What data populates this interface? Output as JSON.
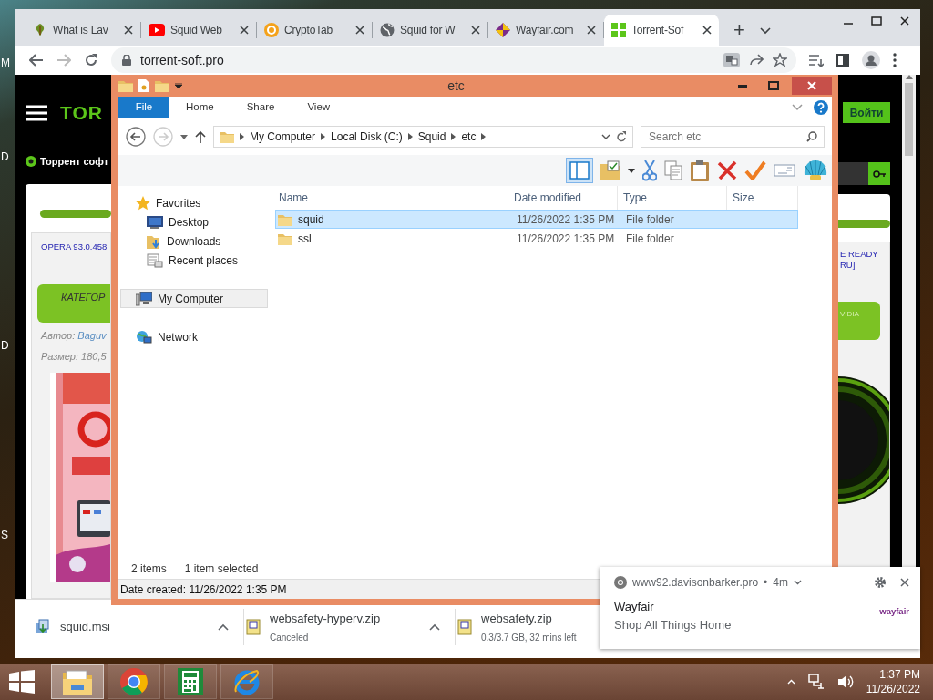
{
  "desktop": {
    "edge_labels": [
      "M",
      "D",
      "D",
      "S"
    ]
  },
  "browser": {
    "tabs": [
      {
        "title": "What is Lav",
        "selected": false
      },
      {
        "title": "Squid Web",
        "selected": false
      },
      {
        "title": "CryptoTab",
        "selected": false
      },
      {
        "title": "Squid for W",
        "selected": false
      },
      {
        "title": "Wayfair.com",
        "selected": false
      },
      {
        "title": "Torrent-Sof",
        "selected": true
      }
    ],
    "new_tab": "+",
    "url": "torrent-soft.pro",
    "page": {
      "logo": "TOR",
      "site_link": "Торрент софт",
      "login_button": "Войти",
      "post_title_left": "OPERA 93.0.458",
      "post_title_right": [
        "E READY",
        "RU]"
      ],
      "category_left": "КАТЕГОР",
      "category_right": "VIDIA",
      "author_label": "Автор:",
      "author": "Baguv",
      "size": "Размер: 180,5"
    },
    "downloads": [
      {
        "name": "squid.msi"
      },
      {
        "name": "websafety-hyperv.zip",
        "status": "Canceled"
      },
      {
        "name": "websafety.zip",
        "status": "0.3/3.7 GB, 32 mins left"
      }
    ]
  },
  "explorer": {
    "title": "etc",
    "ribbon_tabs": [
      {
        "label": "File",
        "kind": "menu",
        "selected": false
      },
      {
        "label": "Home",
        "kind": "tab",
        "selected": false
      },
      {
        "label": "Share",
        "kind": "tab",
        "selected": false
      },
      {
        "label": "View",
        "kind": "tab",
        "selected": false
      }
    ],
    "breadcrumb": [
      "My Computer",
      "Local Disk (C:)",
      "Squid",
      "etc"
    ],
    "search": {
      "placeholder": "Search etc"
    },
    "nav": [
      {
        "label": "Favorites",
        "selected": false,
        "children": [
          {
            "label": "Desktop",
            "selected": false
          },
          {
            "label": "Downloads",
            "selected": false
          },
          {
            "label": "Recent places",
            "selected": false
          }
        ]
      },
      {
        "label": "My Computer",
        "selected": true
      },
      {
        "label": "Network",
        "selected": false
      }
    ],
    "columns": [
      "Name",
      "Date modified",
      "Type",
      "Size"
    ],
    "files": [
      {
        "name": "squid",
        "date": "11/26/2022 1:35 PM",
        "type": "File folder",
        "selected": true
      },
      {
        "name": "ssl",
        "date": "11/26/2022 1:35 PM",
        "type": "File folder",
        "selected": false
      }
    ],
    "status": {
      "count": "2 items",
      "selection": "1 item selected"
    },
    "details": "Date created: 11/26/2022 1:35 PM"
  },
  "notification": {
    "site": "www92.davisonbarker.pro",
    "separator": "•",
    "age": "4m",
    "title": "Wayfair",
    "body": "Shop All Things Home",
    "logo": "wayfair"
  },
  "taskbar": {
    "apps": [
      {
        "selected": true
      },
      {
        "selected": false
      },
      {
        "selected": false
      },
      {
        "selected": false
      }
    ],
    "time": "1:37 PM",
    "date": "11/26/2022"
  }
}
